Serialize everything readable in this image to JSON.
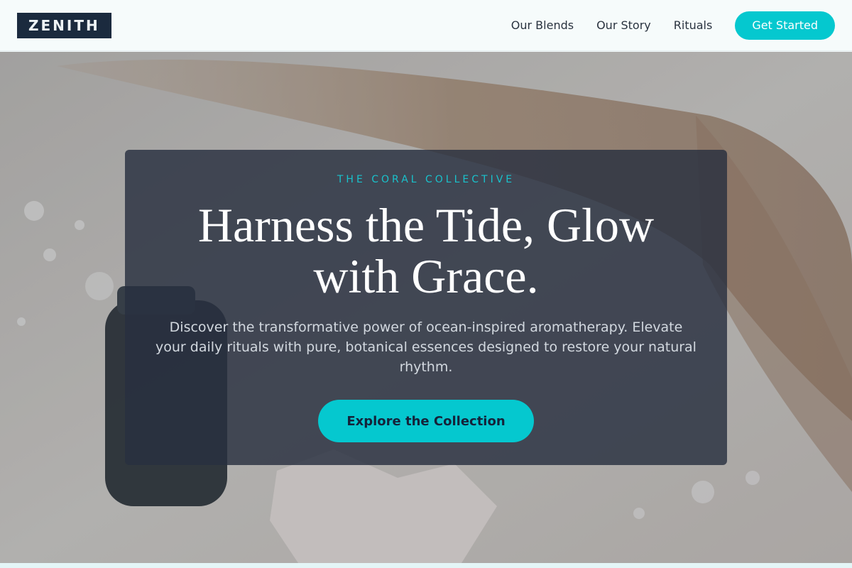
{
  "brand": {
    "logo": "ZENITH"
  },
  "nav": {
    "items": [
      {
        "label": "Our Blends"
      },
      {
        "label": "Our Story"
      },
      {
        "label": "Rituals"
      }
    ],
    "cta_label": "Get Started"
  },
  "hero": {
    "eyebrow": "THE CORAL COLLECTIVE",
    "headline": "Harness the Tide, Glow with Grace.",
    "description": "Discover the transformative power of ocean-inspired aromatherapy. Elevate your daily rituals with pure, botanical essences designed to restore your natural rhythm.",
    "cta_label": "Explore the Collection"
  },
  "colors": {
    "accent": "#05c8cf",
    "brand_dark": "#1b2a3e",
    "card_bg": "#283040"
  }
}
